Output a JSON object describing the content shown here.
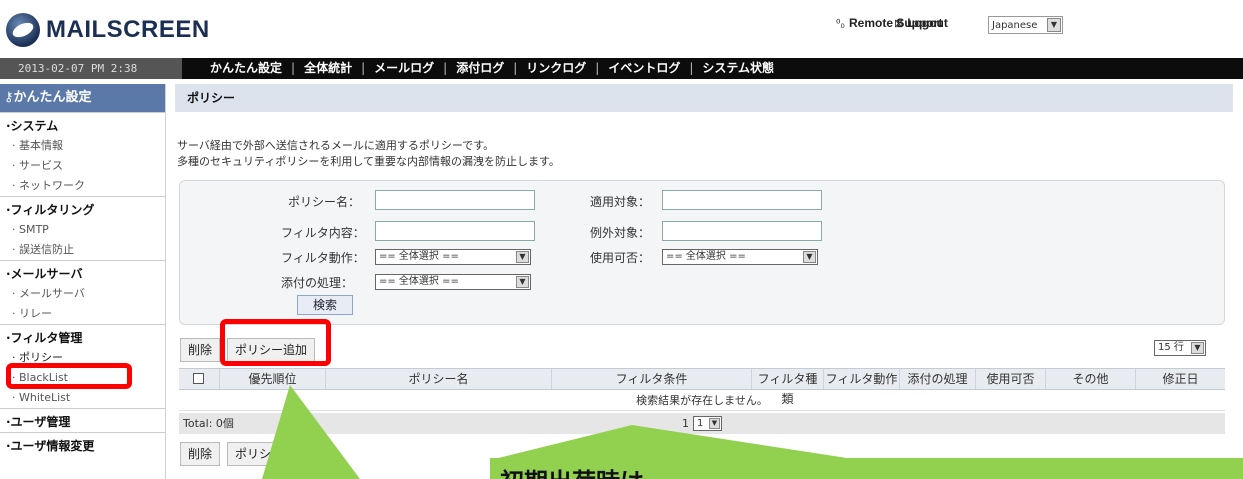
{
  "header": {
    "logo_text": "MAILSCREEN",
    "remote_support": "Remote Support",
    "logout": "Logout",
    "language": "Japanese"
  },
  "navbar": {
    "datetime": "2013-02-07 PM 2:38",
    "menu": [
      "かんたん設定",
      "全体統計",
      "メールログ",
      "添付ログ",
      "リンクログ",
      "イベントログ",
      "システム状態"
    ],
    "separator": "|"
  },
  "sidebar": {
    "title": "かんたん設定",
    "groups": [
      {
        "label": "·システム",
        "items": [
          "· 基本情報",
          "· サービス",
          "· ネットワーク"
        ]
      },
      {
        "label": "·フィルタリング",
        "items": [
          "· SMTP",
          "· 誤送信防止"
        ]
      },
      {
        "label": "·メールサーバ",
        "items": [
          "· メールサーバ",
          "· リレー"
        ]
      },
      {
        "label": "·フィルタ管理",
        "items": [
          "· ポリシー",
          "· BlackList",
          "· WhiteList"
        ]
      },
      {
        "label": "·ユーザ管理",
        "items": []
      },
      {
        "label": "·ユーザ情報変更",
        "items": []
      }
    ]
  },
  "main": {
    "title": "ポリシー",
    "desc_line1": "サーバ経由で外部へ送信されるメールに適用するポリシーです。",
    "desc_line2": "多種のセキュリティポリシーを利用して重要な内部情報の漏洩を防止します。",
    "search": {
      "policy_name_label": "ポリシー名：",
      "target_label": "適用対象：",
      "filter_content_label": "フィルタ内容：",
      "exception_label": "例外対象：",
      "filter_action_label": "フィルタ動作：",
      "filter_action_value": "== 全体選択 ==",
      "enabled_label": "使用可否：",
      "enabled_value": "== 全体選択 ==",
      "attach_label": "添付の処理：",
      "attach_value": "== 全体選択 ==",
      "search_button": "検索"
    },
    "delete_button": "削除",
    "add_policy_button": "ポリシー追加",
    "rows_per_page": "15 行",
    "table_headers": [
      "優先順位",
      "ポリシー名",
      "フィルタ条件",
      "フィルタ種類",
      "フィルタ動作",
      "添付の処理",
      "使用可否",
      "その他",
      "修正日"
    ],
    "empty_message": "検索結果が存在しません。",
    "total": "Total: 0個",
    "page_label": "1",
    "page_select": "1",
    "bottom_delete_button": "削除",
    "bottom_add_button_partial": "ポリシ"
  },
  "annotation": {
    "callout_text": "初期出荷時は",
    "highlight_color": "#ff0000",
    "callout_color": "#92d050"
  }
}
